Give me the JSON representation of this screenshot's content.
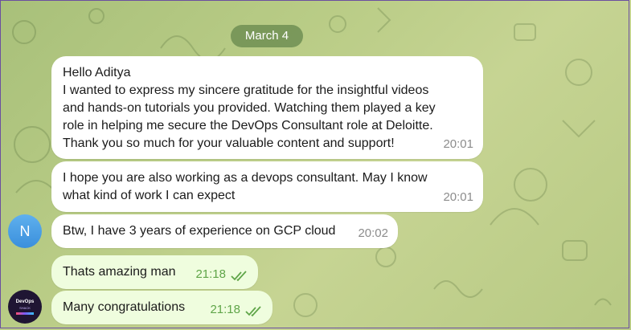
{
  "date_separator": "March 4",
  "messages": [
    {
      "text": "Hello Aditya\nI wanted to express my sincere gratitude for the insightful videos\nand hands-on tutorials you provided. Watching them played a key\nrole in helping me secure the DevOps Consultant role at Deloitte.\nThank you so much for your valuable content and support!",
      "time": "20:01",
      "direction": "incoming"
    },
    {
      "text": "I hope you are also working as a devops consultant. May I know\nwhat kind of work I can expect",
      "time": "20:01",
      "direction": "incoming"
    },
    {
      "text": "Btw, I have 3 years of experience on GCP cloud",
      "time": "20:02",
      "direction": "incoming",
      "avatar_initial": "N"
    },
    {
      "text": "Thats amazing man",
      "time": "21:18",
      "direction": "outgoing",
      "status": "read"
    },
    {
      "text": "Many congratulations",
      "time": "21:18",
      "direction": "outgoing",
      "status": "read"
    }
  ],
  "avatars": {
    "incoming_initial": "N",
    "outgoing_logo_text": "DevOps",
    "outgoing_logo_subtext": "SHACK",
    "incoming_color": "#4a9ee6",
    "outgoing_color": "#1f1533"
  },
  "colors": {
    "incoming_bubble": "#ffffff",
    "outgoing_bubble": "#effdde",
    "read_checks": "#5fa548",
    "date_pill": "#65874c"
  },
  "icons": {
    "read_status": "double-check-icon",
    "background": "doodle-pattern"
  }
}
